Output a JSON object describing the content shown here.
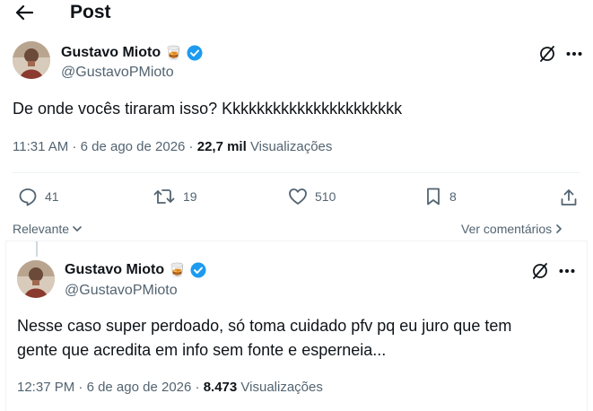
{
  "header": {
    "title": "Post"
  },
  "main_post": {
    "author_name": "Gustavo Mioto",
    "author_emoji": "🥃",
    "handle": "@GustavoPMioto",
    "text": "De onde vocês tiraram isso? Kkkkkkkkkkkkkkkkkkkkkk",
    "time": "11:31 AM",
    "date": "6 de ago de 2026",
    "views_count": "22,7 mil",
    "views_label": "Visualizações",
    "replies": "41",
    "reposts": "19",
    "likes": "510",
    "bookmarks": "8"
  },
  "filters": {
    "sort_label": "Relevante",
    "view_comments_label": "Ver comentários"
  },
  "reply_post": {
    "author_name": "Gustavo Mioto",
    "author_emoji": "🥃",
    "handle": "@GustavoPMioto",
    "text": "Nesse caso super perdoado, só toma cuidado pfv pq eu juro que tem gente que acredita em info sem fonte e esperneia...",
    "time": "12:37 PM",
    "date": "6 de ago de 2026",
    "views_count": "8.473",
    "views_label": "Visualizações"
  },
  "colors": {
    "verified": "#1d9bf0",
    "muted": "#536471",
    "text": "#0f1419"
  },
  "icons": [
    "back-arrow-icon",
    "verified-badge-icon",
    "grok-icon",
    "more-icon",
    "reply-icon",
    "repost-icon",
    "like-icon",
    "bookmark-icon",
    "share-icon",
    "chevron-down-icon",
    "chevron-right-icon"
  ]
}
